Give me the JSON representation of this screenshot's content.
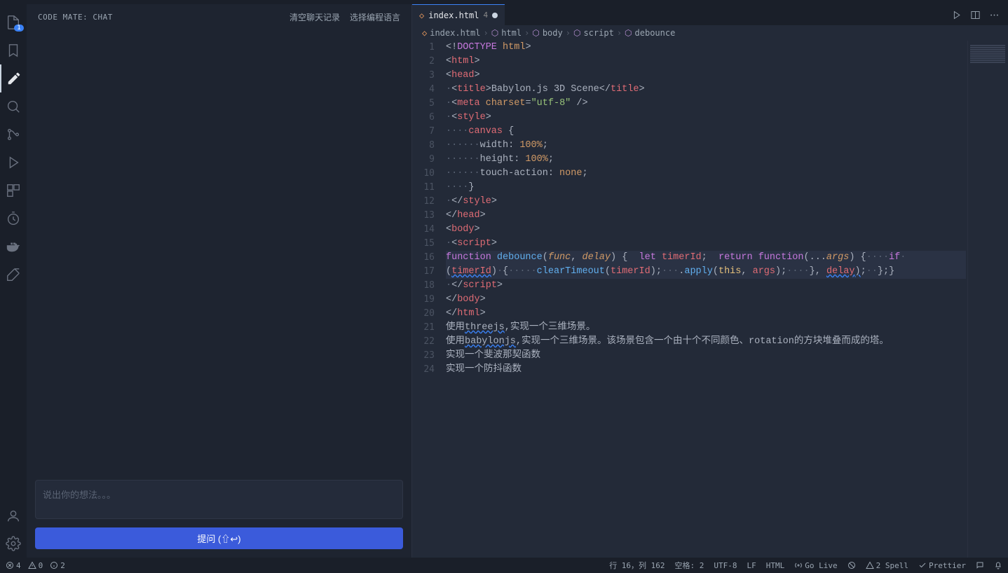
{
  "side_panel": {
    "title": "CODE MATE: CHAT",
    "actions": [
      "清空聊天记录",
      "选择编程语言"
    ],
    "input_placeholder": "说出你的想法。。。",
    "ask_button": "提问 (⇧↩)"
  },
  "activity_badge": "1",
  "tab": {
    "name": "index.html",
    "problem_count": "4"
  },
  "breadcrumbs": [
    "index.html",
    "html",
    "body",
    "script",
    "debounce"
  ],
  "code_lines": [
    {
      "n": 1,
      "segs": [
        [
          "<!",
          "t-punc"
        ],
        [
          "DOCTYPE",
          "t-doctype"
        ],
        [
          " ",
          ""
        ],
        [
          "html",
          "t-attr"
        ],
        [
          ">",
          "t-punc"
        ]
      ]
    },
    {
      "n": 2,
      "segs": [
        [
          "<",
          "t-punc"
        ],
        [
          "html",
          "t-tag"
        ],
        [
          ">",
          "t-punc"
        ]
      ]
    },
    {
      "n": 3,
      "segs": [
        [
          "<",
          "t-punc"
        ],
        [
          "head",
          "t-tag"
        ],
        [
          ">",
          "t-punc"
        ]
      ]
    },
    {
      "n": 4,
      "segs": [
        [
          "·",
          "t-dim"
        ],
        [
          "<",
          "t-punc"
        ],
        [
          "title",
          "t-tag"
        ],
        [
          ">",
          "t-punc"
        ],
        [
          "Babylon.js 3D Scene",
          "t-txt"
        ],
        [
          "</",
          "t-punc"
        ],
        [
          "title",
          "t-tag"
        ],
        [
          ">",
          "t-punc"
        ]
      ]
    },
    {
      "n": 5,
      "segs": [
        [
          "·",
          "t-dim"
        ],
        [
          "<",
          "t-punc"
        ],
        [
          "meta",
          "t-tag"
        ],
        [
          " ",
          ""
        ],
        [
          "charset",
          "t-attr"
        ],
        [
          "=",
          "t-punc"
        ],
        [
          "\"utf-8\"",
          "t-str"
        ],
        [
          " />",
          "t-punc"
        ]
      ]
    },
    {
      "n": 6,
      "segs": [
        [
          "·",
          "t-dim"
        ],
        [
          "<",
          "t-punc"
        ],
        [
          "style",
          "t-tag"
        ],
        [
          ">",
          "t-punc"
        ]
      ]
    },
    {
      "n": 7,
      "segs": [
        [
          "····",
          "t-dim"
        ],
        [
          "canvas",
          "t-tag"
        ],
        [
          " {",
          "t-punc"
        ]
      ]
    },
    {
      "n": 8,
      "segs": [
        [
          "······",
          "t-dim"
        ],
        [
          "width",
          "t-prop"
        ],
        [
          ": ",
          "t-punc"
        ],
        [
          "100%",
          "t-num"
        ],
        [
          ";",
          "t-punc"
        ]
      ]
    },
    {
      "n": 9,
      "segs": [
        [
          "······",
          "t-dim"
        ],
        [
          "height",
          "t-prop"
        ],
        [
          ": ",
          "t-punc"
        ],
        [
          "100%",
          "t-num"
        ],
        [
          ";",
          "t-punc"
        ]
      ]
    },
    {
      "n": 10,
      "segs": [
        [
          "······",
          "t-dim"
        ],
        [
          "touch-action",
          "t-prop"
        ],
        [
          ": ",
          "t-punc"
        ],
        [
          "none",
          "t-num"
        ],
        [
          ";",
          "t-punc"
        ]
      ]
    },
    {
      "n": 11,
      "segs": [
        [
          "····",
          "t-dim"
        ],
        [
          "}",
          "t-punc"
        ]
      ]
    },
    {
      "n": 12,
      "segs": [
        [
          "·",
          "t-dim"
        ],
        [
          "</",
          "t-punc"
        ],
        [
          "style",
          "t-tag"
        ],
        [
          ">",
          "t-punc"
        ]
      ]
    },
    {
      "n": 13,
      "segs": [
        [
          "</",
          "t-punc"
        ],
        [
          "head",
          "t-tag"
        ],
        [
          ">",
          "t-punc"
        ]
      ]
    },
    {
      "n": 14,
      "segs": [
        [
          "<",
          "t-punc"
        ],
        [
          "body",
          "t-tag"
        ],
        [
          ">",
          "t-punc"
        ]
      ]
    },
    {
      "n": 15,
      "segs": [
        [
          "·",
          "t-dim"
        ],
        [
          "<",
          "t-punc"
        ],
        [
          "script",
          "t-tag"
        ],
        [
          ">",
          "t-punc"
        ]
      ]
    },
    {
      "n": 16,
      "hl": true,
      "segs": [
        [
          "function",
          "t-kw"
        ],
        [
          " ",
          ""
        ],
        [
          "debounce",
          "t-fn"
        ],
        [
          "(",
          "t-punc"
        ],
        [
          "func",
          "t-param"
        ],
        [
          ",",
          "t-punc"
        ],
        [
          " ",
          ""
        ],
        [
          "delay",
          "t-param"
        ],
        [
          ")",
          "t-punc"
        ],
        [
          " { ",
          "t-punc"
        ],
        [
          " ",
          ""
        ],
        [
          "let",
          "t-kw"
        ],
        [
          " ",
          ""
        ],
        [
          "timerId",
          "t-var"
        ],
        [
          ";",
          "t-punc"
        ],
        [
          "  ",
          ""
        ],
        [
          "return",
          "t-kw"
        ],
        [
          " ",
          ""
        ],
        [
          "function",
          "t-kw"
        ],
        [
          "(",
          "t-punc"
        ],
        [
          "...",
          "t-punc"
        ],
        [
          "args",
          "t-param"
        ],
        [
          ")",
          "t-punc"
        ],
        [
          " {",
          "t-punc"
        ],
        [
          "····",
          "t-dim"
        ],
        [
          "if",
          "t-kw"
        ],
        [
          "·",
          "t-dim"
        ]
      ]
    },
    {
      "n": "",
      "hl": true,
      "segs": [
        [
          "(",
          "t-punc"
        ],
        [
          "timerId",
          "t-var wavy"
        ],
        [
          ")",
          "t-punc"
        ],
        [
          "·",
          "t-dim"
        ],
        [
          "{",
          "t-punc"
        ],
        [
          "·····",
          "t-dim"
        ],
        [
          "clearTimeout",
          "t-fn"
        ],
        [
          "(",
          "t-punc"
        ],
        [
          "timerId",
          "t-var"
        ],
        [
          ")",
          "t-punc"
        ],
        [
          ";",
          "t-punc"
        ],
        [
          "···",
          "t-dim"
        ],
        [
          ".",
          "t-punc"
        ],
        [
          "apply",
          "t-fn"
        ],
        [
          "(",
          "t-punc"
        ],
        [
          "this",
          "t-this"
        ],
        [
          ", ",
          "t-punc"
        ],
        [
          "args",
          "t-var"
        ],
        [
          ")",
          "t-punc"
        ],
        [
          ";",
          "t-punc"
        ],
        [
          "····",
          "t-dim"
        ],
        [
          "}",
          "t-punc"
        ],
        [
          ", ",
          "t-punc"
        ],
        [
          "delay",
          "t-var wavy"
        ],
        [
          ")",
          "t-punc wavy"
        ],
        [
          ";",
          "t-punc"
        ],
        [
          "··",
          "t-dim"
        ],
        [
          "}",
          "t-punc"
        ],
        [
          ";",
          "t-punc"
        ],
        [
          "}",
          "t-punc"
        ]
      ]
    },
    {
      "n": 17,
      "segs": [
        [
          "·",
          "t-dim"
        ],
        [
          "</",
          "t-punc"
        ],
        [
          "script",
          "t-tag"
        ],
        [
          ">",
          "t-punc"
        ]
      ]
    },
    {
      "n": 18,
      "segs": [
        [
          "</",
          "t-punc"
        ],
        [
          "body",
          "t-tag"
        ],
        [
          ">",
          "t-punc"
        ]
      ]
    },
    {
      "n": 19,
      "segs": [
        [
          "</",
          "t-punc"
        ],
        [
          "html",
          "t-tag"
        ],
        [
          ">",
          "t-punc"
        ]
      ]
    },
    {
      "n": 20,
      "segs": [
        [
          "使用",
          "t-txt"
        ],
        [
          "threejs",
          "t-txt wavy"
        ],
        [
          ",实现一个三维场景。",
          "t-txt"
        ]
      ]
    },
    {
      "n": 21,
      "segs": [
        [
          "使用",
          "t-txt"
        ],
        [
          "babylonjs",
          "t-txt wavy"
        ],
        [
          ",实现一个三维场景。该场景包含一个由十个不同颜色、rotation的方块堆叠而成的塔。",
          "t-txt"
        ]
      ]
    },
    {
      "n": 22,
      "segs": [
        [
          "实现一个斐波那契函数",
          "t-txt"
        ]
      ]
    },
    {
      "n": 23,
      "segs": [
        [
          "实现一个防抖函数",
          "t-txt"
        ]
      ]
    },
    {
      "n": 24,
      "segs": []
    }
  ],
  "status": {
    "errors": "4",
    "warnings": "0",
    "info": "2",
    "cursor": "行 16，列 162",
    "spaces": "空格: 2",
    "encoding": "UTF-8",
    "eol": "LF",
    "lang": "HTML",
    "live": "Go Live",
    "spell": "2 Spell",
    "prettier": "Prettier"
  }
}
